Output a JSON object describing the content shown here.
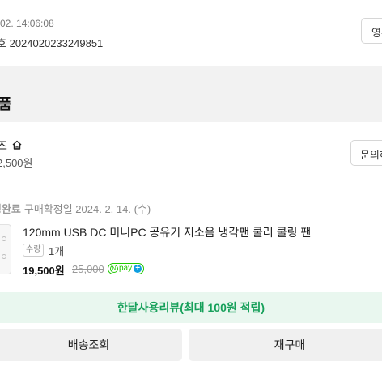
{
  "order": {
    "date": "02. 14:06:08",
    "number_label": "호",
    "number": "2024020233249851",
    "receipt_button": "영수증"
  },
  "section": {
    "title": "품"
  },
  "store": {
    "name": "즈",
    "home_icon": "home-icon",
    "delivery_fee": "2,500원",
    "inquiry_button": "문의하기"
  },
  "item": {
    "status": "정완료",
    "confirm_date": "구매확정일 2024. 2. 14. (수)",
    "product_name": "120mm USB DC 미니PC 공유기 저소음 냉각팬 쿨러 쿨링 팬",
    "qty_label": "수량",
    "qty_value": "1개",
    "price": "19,500원",
    "original_price": "25,000",
    "npay_label": "pay",
    "npay_n": "N",
    "npay_plus": "+",
    "colors": {
      "npay_green": "#1ec800",
      "review_green": "#16a05a"
    }
  },
  "review_banner": "한달사용리뷰(최대 100원 적립)",
  "actions": {
    "track": "배송조회",
    "reorder": "재구매"
  }
}
